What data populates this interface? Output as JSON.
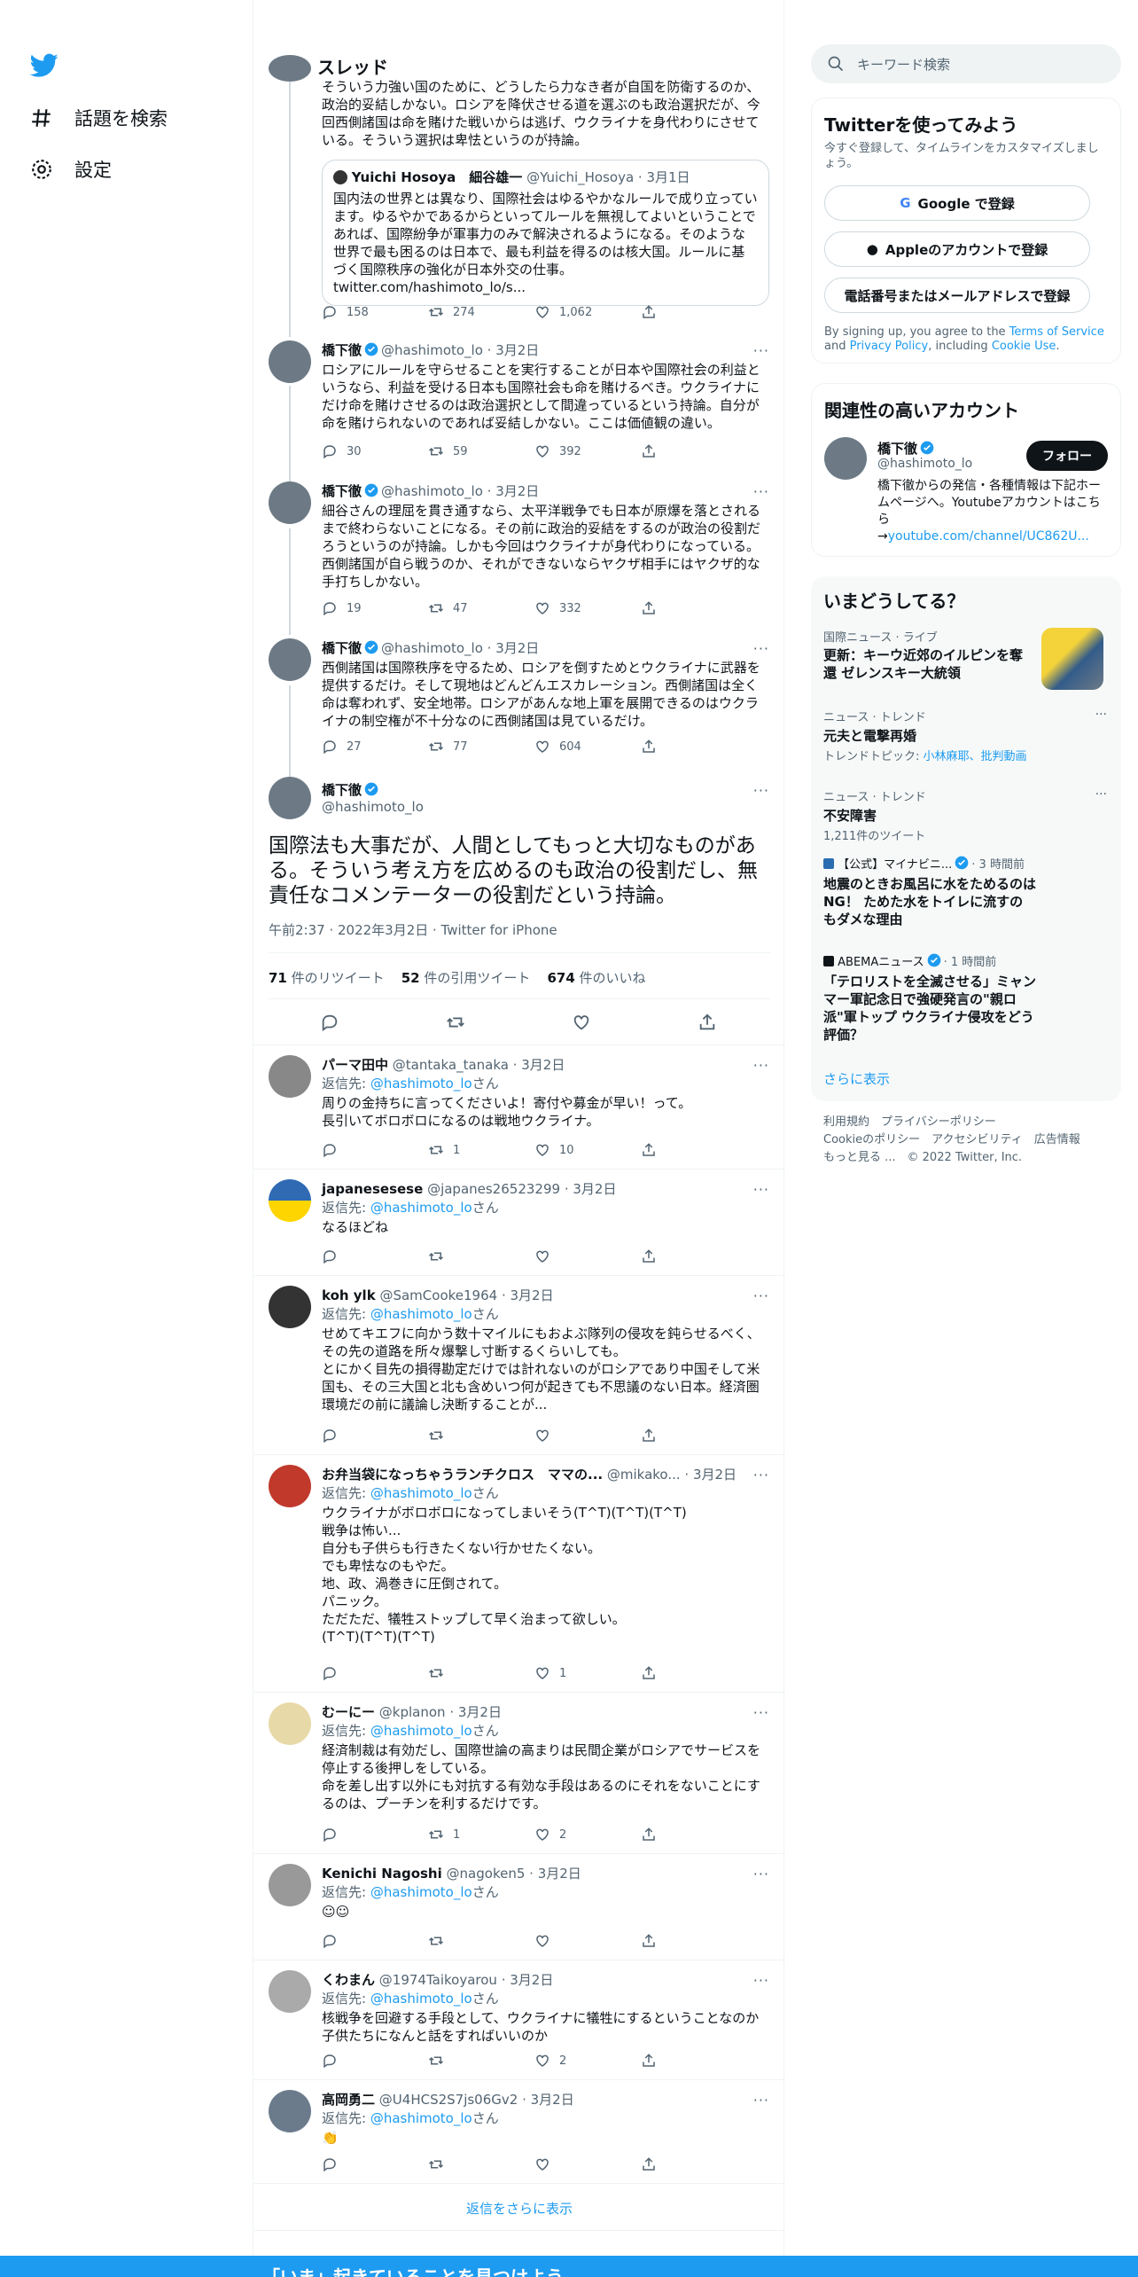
{
  "nav": {
    "explore": "話題を検索",
    "settings": "設定"
  },
  "header": {
    "title": "スレッド"
  },
  "thread": {
    "top_text": "そういう力強い国のために、どうしたら力なき者が自国を防衛するのか、政治的妥結しかない。ロシアを降伏させる道を選ぶのも政治選択だが、今回西側諸国は命を賭けた戦いからは逃げ、ウクライナを身代わりにさせている。そういう選択は卑怯というのが持論。",
    "quote": {
      "name": "Yuichi Hosoya　細谷雄一",
      "handle": "@Yuichi_Hosoya",
      "date": "3月1日",
      "text": "国内法の世界とは異なり、国際社会はゆるやかなルールで成り立っています。ゆるやかであるからといってルールを無視してよいということであれば、国際紛争が軍事力のみで解決されるようになる。そのような世界で最も困るのは日本で、最も利益を得るのは核大国。ルールに基づく国際秩序の強化が日本外交の仕事。 twitter.com/hashimoto_lo/s..."
    },
    "top_stats": {
      "reply": "158",
      "rt": "274",
      "like": "1,062"
    },
    "t2": {
      "name": "橋下徹",
      "handle": "@hashimoto_lo",
      "date": "3月2日",
      "text": "ロシアにルールを守らせることを実行することが日本や国際社会の利益というなら、利益を受ける日本も国際社会も命を賭けるべき。ウクライナにだけ命を賭けさせるのは政治選択として間違っているという持論。自分が命を賭けられないのであれば妥結しかない。ここは価値観の違い。",
      "reply": "30",
      "rt": "59",
      "like": "392"
    },
    "t3": {
      "name": "橋下徹",
      "handle": "@hashimoto_lo",
      "date": "3月2日",
      "text": "細谷さんの理屈を貫き通すなら、太平洋戦争でも日本が原爆を落とされるまで終わらないことになる。その前に政治的妥結をするのが政治の役割だろうというのが持論。しかも今回はウクライナが身代わりになっている。西側諸国が自ら戦うのか、それができないならヤクザ相手にはヤクザ的な手打ちしかない。",
      "reply": "19",
      "rt": "47",
      "like": "332"
    },
    "t4": {
      "name": "橋下徹",
      "handle": "@hashimoto_lo",
      "date": "3月2日",
      "text": "西側諸国は国際秩序を守るため、ロシアを倒すためとウクライナに武器を提供するだけ。そして現地はどんどんエスカレーション。西側諸国は全く命は奪われず、安全地帯。ロシアがあんな地上軍を展開できるのはウクライナの制空権が不十分なのに西側諸国は見ているだけ。",
      "reply": "27",
      "rt": "77",
      "like": "604"
    },
    "focus": {
      "name": "橋下徹",
      "handle": "@hashimoto_lo",
      "text": "国際法も大事だが、人間としてもっと大切なものがある。そういう考え方を広めるのも政治の役割だし、無責任なコメンテーターの役割だという持論。",
      "time": "午前2:37 · 2022年3月2日 · Twitter for iPhone",
      "rt_count": "71",
      "rt_label": " 件のリツイート",
      "quote_count": "52",
      "quote_label": " 件の引用ツイート",
      "like_count": "674",
      "like_label": " 件のいいね"
    }
  },
  "replying_label": "返信先: ",
  "replying_handle": "@hashimoto_lo",
  "replying_suffix": "さん",
  "replies": [
    {
      "name": "パーマ田中",
      "handle": "@tantaka_tanaka",
      "date": "3月2日",
      "text": "周りの金持ちに言ってくださいよ！寄付や募金が早い！って。\n長引いてボロボロになるのは戦地ウクライナ。",
      "reply": "",
      "rt": "1",
      "like": "10"
    },
    {
      "name": "japanesesese",
      "handle": "@japanes26523299",
      "date": "3月2日",
      "text": "なるほどね",
      "reply": "",
      "rt": "",
      "like": ""
    },
    {
      "name": "koh ylk",
      "handle": "@SamCooke1964",
      "date": "3月2日",
      "text": "せめてキエフに向かう数十マイルにもおよぶ隊列の侵攻を鈍らせるべく、その先の道路を所々爆撃し寸断するくらいしても。\nとにかく目先の損得勘定だけでは計れないのがロシアであり中国そして米国も、その三大国と北も含めいつ何が起きても不思議のない日本。経済圏環境だの前に議論し決断することが...",
      "reply": "",
      "rt": "",
      "like": ""
    },
    {
      "name": "お弁当袋になっちゃうランチクロス　ママの...",
      "handle": "@mikako...",
      "date": "3月2日",
      "text": "ウクライナがボロボロになってしまいそう(T^T)(T^T)(T^T)\n戦争は怖い...\n自分も子供らも行きたくない行かせたくない。\nでも卑怯なのもやだ。\n地、政、渦巻きに圧倒されて。\nパニック。\nただただ、犠牲ストップして早く治まって欲しい。\n(T^T)(T^T)(T^T)",
      "reply": "",
      "rt": "",
      "like": "1"
    },
    {
      "name": "むーにー",
      "handle": "@kplanon",
      "date": "3月2日",
      "text": "経済制裁は有効だし、国際世論の高まりは民間企業がロシアでサービスを停止する後押しをしている。\n命を差し出す以外にも対抗する有効な手段はあるのにそれをないことにするのは、プーチンを利するだけです。",
      "reply": "",
      "rt": "1",
      "like": "2"
    },
    {
      "name": "Kenichi Nagoshi",
      "handle": "@nagoken5",
      "date": "3月2日",
      "text": "☺☺",
      "reply": "",
      "rt": "",
      "like": ""
    },
    {
      "name": "くわまん",
      "handle": "@1974Taikoyarou",
      "date": "3月2日",
      "text": "核戦争を回避する手段として、ウクライナに犠牲にするということなのか子供たちになんと話をすればいいのか",
      "reply": "",
      "rt": "",
      "like": "2"
    },
    {
      "name": "高岡勇二",
      "handle": "@U4HCS2S7js06Gv2",
      "date": "3月2日",
      "text": "👏",
      "reply": "",
      "rt": "",
      "like": ""
    }
  ],
  "show_more_replies": "返信をさらに表示",
  "right": {
    "search_placeholder": "キーワード検索",
    "signup": {
      "title": "Twitterを使ってみよう",
      "sub": "今すぐ登録して、タイムラインをカスタマイズしましょう。",
      "google": "Google で登録",
      "apple": "Appleのアカウントで登録",
      "phone": "電話番号またはメールアドレスで登録",
      "terms_pre": "By signing up, you agree to the ",
      "terms": "Terms of Service",
      "terms_mid": " and ",
      "privacy": "Privacy Policy",
      "terms_mid2": ", including ",
      "cookie": "Cookie Use",
      "terms_end": "."
    },
    "related": {
      "title": "関連性の高いアカウント",
      "name": "橋下徹",
      "handle": "@hashimoto_lo",
      "follow": "フォロー",
      "bio": "橋下徹からの発信・各種情報は下記ホームページへ。Youtubeアカウントはこちら\n→",
      "bio_link": "youtube.com/channel/UC862U..."
    },
    "trends": {
      "title": "いまどうしてる？",
      "t1_cat": "国際ニュース · ライブ",
      "t1_title": "更新：キーウ近郊のイルピンを奪還 ゼレンスキー大統領",
      "t2_cat": "ニュース · トレンド",
      "t2_title": "元夫と電撃再婚",
      "t2_sub_pre": "トレンドトピック: ",
      "t2_sub_link": "小林麻耶、批判動画",
      "t3_cat": "ニュース · トレンド",
      "t3_title": "不安障害",
      "t3_sub": "1,211件のツイート",
      "t4_src": "【公式】マイナビニ...",
      "t4_time": "· 3 時間前",
      "t4_title": "地震のときお風呂に水をためるのはNG！ ためた水をトイレに流すのもダメな理由",
      "t5_src": "ABEMAニュース",
      "t5_time": "· 1 時間前",
      "t5_title": "「テロリストを全滅させる」ミャンマー軍記念日で強硬発言の\"親ロ派\"軍トップ ウクライナ侵攻をどう評価？",
      "more": "さらに表示"
    },
    "footer": {
      "l1": "利用規約　プライバシーポリシー",
      "l2": "Cookieのポリシー　アクセシビリティ　広告情報",
      "l3": "もっと見る ...　© 2022 Twitter, Inc."
    }
  },
  "bottom": {
    "text": "「いま」起きていることを見つけよう"
  }
}
